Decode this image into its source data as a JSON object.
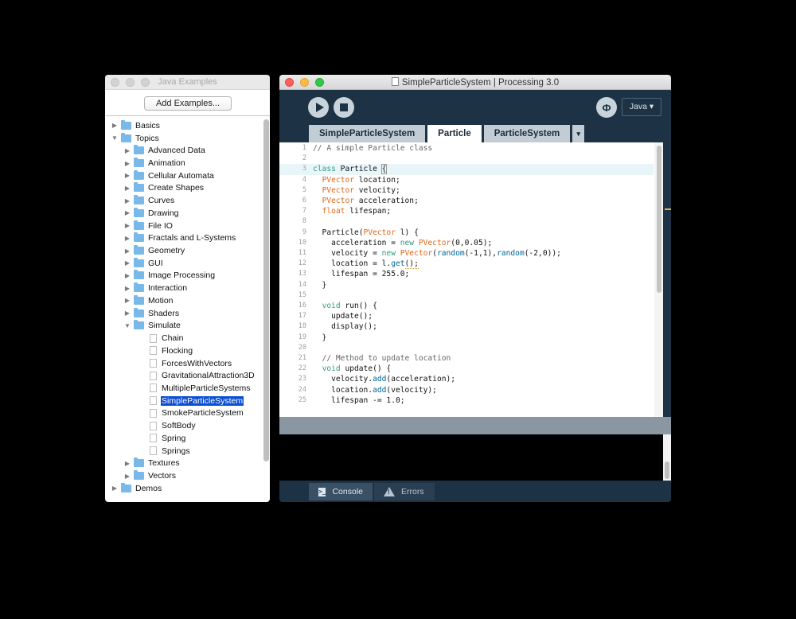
{
  "examples_window": {
    "title": "Java Examples",
    "add_button": "Add Examples...",
    "tree": [
      {
        "label": "Basics",
        "kind": "folder",
        "depth": 0,
        "expanded": false
      },
      {
        "label": "Topics",
        "kind": "folder",
        "depth": 0,
        "expanded": true
      },
      {
        "label": "Advanced Data",
        "kind": "folder",
        "depth": 1,
        "expanded": false
      },
      {
        "label": "Animation",
        "kind": "folder",
        "depth": 1,
        "expanded": false
      },
      {
        "label": "Cellular Automata",
        "kind": "folder",
        "depth": 1,
        "expanded": false
      },
      {
        "label": "Create Shapes",
        "kind": "folder",
        "depth": 1,
        "expanded": false
      },
      {
        "label": "Curves",
        "kind": "folder",
        "depth": 1,
        "expanded": false
      },
      {
        "label": "Drawing",
        "kind": "folder",
        "depth": 1,
        "expanded": false
      },
      {
        "label": "File IO",
        "kind": "folder",
        "depth": 1,
        "expanded": false
      },
      {
        "label": "Fractals and L-Systems",
        "kind": "folder",
        "depth": 1,
        "expanded": false
      },
      {
        "label": "Geometry",
        "kind": "folder",
        "depth": 1,
        "expanded": false
      },
      {
        "label": "GUI",
        "kind": "folder",
        "depth": 1,
        "expanded": false
      },
      {
        "label": "Image Processing",
        "kind": "folder",
        "depth": 1,
        "expanded": false
      },
      {
        "label": "Interaction",
        "kind": "folder",
        "depth": 1,
        "expanded": false
      },
      {
        "label": "Motion",
        "kind": "folder",
        "depth": 1,
        "expanded": false
      },
      {
        "label": "Shaders",
        "kind": "folder",
        "depth": 1,
        "expanded": false
      },
      {
        "label": "Simulate",
        "kind": "folder",
        "depth": 1,
        "expanded": true
      },
      {
        "label": "Chain",
        "kind": "file",
        "depth": 2
      },
      {
        "label": "Flocking",
        "kind": "file",
        "depth": 2
      },
      {
        "label": "ForcesWithVectors",
        "kind": "file",
        "depth": 2
      },
      {
        "label": "GravitationalAttraction3D",
        "kind": "file",
        "depth": 2
      },
      {
        "label": "MultipleParticleSystems",
        "kind": "file",
        "depth": 2
      },
      {
        "label": "SimpleParticleSystem",
        "kind": "file",
        "depth": 2,
        "selected": true
      },
      {
        "label": "SmokeParticleSystem",
        "kind": "file",
        "depth": 2
      },
      {
        "label": "SoftBody",
        "kind": "file",
        "depth": 2
      },
      {
        "label": "Spring",
        "kind": "file",
        "depth": 2
      },
      {
        "label": "Springs",
        "kind": "file",
        "depth": 2
      },
      {
        "label": "Textures",
        "kind": "folder",
        "depth": 1,
        "expanded": false
      },
      {
        "label": "Vectors",
        "kind": "folder",
        "depth": 1,
        "expanded": false
      },
      {
        "label": "Demos",
        "kind": "folder",
        "depth": 0,
        "expanded": false
      }
    ]
  },
  "pde_window": {
    "title": "SimpleParticleSystem | Processing 3.0",
    "mode": "Java ▾",
    "debug_icon": "butterfly-icon",
    "tabs": [
      {
        "label": "SimpleParticleSystem",
        "active": false
      },
      {
        "label": "Particle",
        "active": true
      },
      {
        "label": "ParticleSystem",
        "active": false
      }
    ],
    "tab_menu": "▾",
    "current_line": 3,
    "code": [
      [
        [
          "cm",
          "// A simple Particle class"
        ]
      ],
      [],
      [
        [
          "kw",
          "class"
        ],
        [
          "",
          " Particle "
        ],
        [
          "br",
          "{"
        ]
      ],
      [
        [
          "",
          "  "
        ],
        [
          "ty",
          "PVector"
        ],
        [
          "",
          " location;"
        ]
      ],
      [
        [
          "",
          "  "
        ],
        [
          "ty",
          "PVector"
        ],
        [
          "",
          " velocity;"
        ]
      ],
      [
        [
          "",
          "  "
        ],
        [
          "ty",
          "PVector"
        ],
        [
          "",
          " acceleration;"
        ]
      ],
      [
        [
          "",
          "  "
        ],
        [
          "ty",
          "float"
        ],
        [
          "",
          " lifespan;"
        ]
      ],
      [],
      [
        [
          "",
          "  Particle("
        ],
        [
          "ty",
          "PVector"
        ],
        [
          "",
          " l) {"
        ]
      ],
      [
        [
          "",
          "    acceleration = "
        ],
        [
          "kw",
          "new"
        ],
        [
          "",
          " "
        ],
        [
          "ty",
          "PVector"
        ],
        [
          "",
          "(0,0.05);"
        ]
      ],
      [
        [
          "",
          "    velocity = "
        ],
        [
          "kw",
          "new"
        ],
        [
          "",
          " "
        ],
        [
          "ty",
          "PVector"
        ],
        [
          "",
          "("
        ],
        [
          "fn",
          "random"
        ],
        [
          "",
          "(-1,1),"
        ],
        [
          "fn",
          "random"
        ],
        [
          "",
          "(-2,0));"
        ]
      ],
      [
        [
          "",
          "    location = l."
        ],
        [
          "fn",
          "get"
        ],
        [
          "sq",
          "();"
        ]
      ],
      [
        [
          "",
          "    lifespan = 255.0;"
        ]
      ],
      [
        [
          "",
          "  }"
        ]
      ],
      [],
      [
        [
          "",
          "  "
        ],
        [
          "kw",
          "void"
        ],
        [
          "",
          " run() {"
        ]
      ],
      [
        [
          "",
          "    update();"
        ]
      ],
      [
        [
          "",
          "    display();"
        ]
      ],
      [
        [
          "",
          "  }"
        ]
      ],
      [],
      [
        [
          "",
          "  "
        ],
        [
          "cm",
          "// Method to update location"
        ]
      ],
      [
        [
          "",
          "  "
        ],
        [
          "kw",
          "void"
        ],
        [
          "",
          " update() {"
        ]
      ],
      [
        [
          "",
          "    velocity."
        ],
        [
          "fn",
          "add"
        ],
        [
          "",
          "(acceleration);"
        ]
      ],
      [
        [
          "",
          "    location."
        ],
        [
          "fn",
          "add"
        ],
        [
          "",
          "(velocity);"
        ]
      ],
      [
        [
          "",
          "    lifespan -= 1.0;"
        ]
      ]
    ],
    "footer": {
      "console_label": "Console",
      "errors_label": "Errors"
    }
  }
}
